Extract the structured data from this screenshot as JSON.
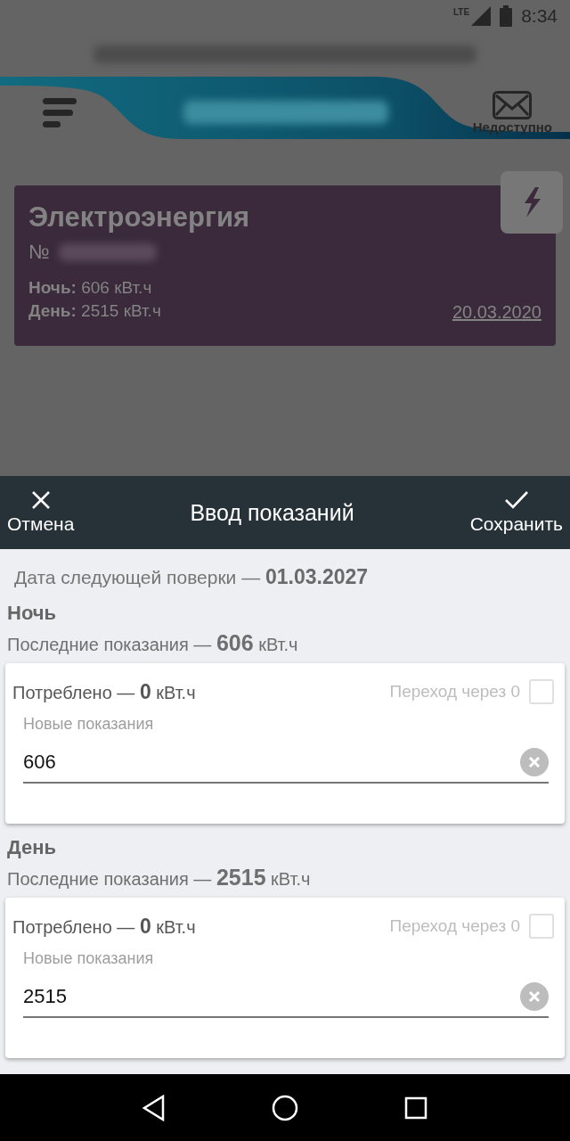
{
  "status_bar": {
    "network": "LTE",
    "time": "8:34"
  },
  "header": {
    "mail_label": "Недоступно"
  },
  "meter_card": {
    "title": "Электроэнергия",
    "number_label": "№",
    "readings": [
      "**Ночь:** 606 кВт.ч",
      "**День:** 2515 кВт.ч"
    ],
    "date": "20.03.2020"
  },
  "sheet": {
    "cancel": "Отмена",
    "title": "Ввод показаний",
    "save": "Сохранить",
    "verification": "Дата следующей поверки — **01.03.2027**",
    "tariffs": [
      {
        "name": "Ночь",
        "last": "Последние показания — **606** кВт.ч",
        "consumed": "Потреблено — **0** кВт.ч",
        "rollover_label": "Переход через 0",
        "rollover_checked": false,
        "field_label": "Новые показания",
        "value": "606"
      },
      {
        "name": "День",
        "last": "Последние показания — **2515** кВт.ч",
        "consumed": "Потреблено — **0** кВт.ч",
        "rollover_label": "Переход через 0",
        "rollover_checked": false,
        "field_label": "Новые показания",
        "value": "2515"
      }
    ]
  }
}
